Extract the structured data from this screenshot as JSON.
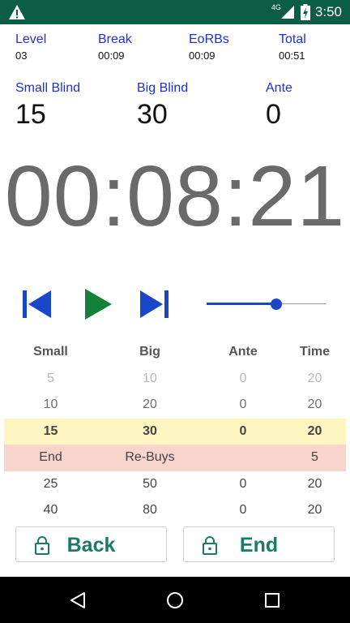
{
  "status_bar": {
    "time": "3:50",
    "network": "4G"
  },
  "stats": [
    {
      "label": "Level",
      "value": "03"
    },
    {
      "label": "Break",
      "value": "00:09"
    },
    {
      "label": "EoRBs",
      "value": "00:09"
    },
    {
      "label": "Total",
      "value": "00:51"
    }
  ],
  "blinds": [
    {
      "label": "Small Blind",
      "value": "15"
    },
    {
      "label": "Big Blind",
      "value": "30"
    },
    {
      "label": "Ante",
      "value": "0"
    }
  ],
  "clock": "00:08:21",
  "slider": {
    "value": 0.58
  },
  "table": {
    "headers": [
      "Small",
      "Big",
      "Ante",
      "Time"
    ],
    "rows": [
      [
        "5",
        "10",
        "0",
        "20"
      ],
      [
        "10",
        "20",
        "0",
        "20"
      ],
      [
        "15",
        "30",
        "0",
        "20"
      ],
      [
        "End",
        "Re-Buys",
        "",
        "5"
      ],
      [
        "25",
        "50",
        "0",
        "20"
      ],
      [
        "40",
        "80",
        "0",
        "20"
      ]
    ]
  },
  "buttons": {
    "back": "Back",
    "end": "End"
  },
  "colors": {
    "accent_blue": "#1a47c7",
    "label_blue": "#1f2fd6",
    "play_green": "#14803a",
    "button_text": "#1b7a66",
    "status_green": "#0b5e45"
  }
}
